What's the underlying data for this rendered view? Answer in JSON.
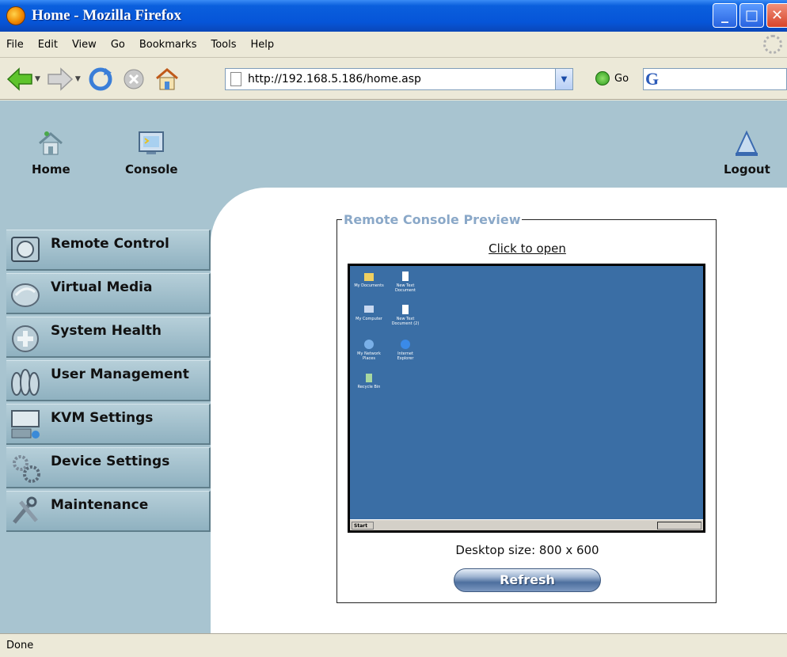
{
  "window": {
    "title": "Home - Mozilla Firefox"
  },
  "menu": [
    "File",
    "Edit",
    "View",
    "Go",
    "Bookmarks",
    "Tools",
    "Help"
  ],
  "toolbar": {
    "url": "http://192.168.5.186/home.asp",
    "go_label": "Go"
  },
  "topnav": {
    "home": "Home",
    "console": "Console",
    "logout": "Logout"
  },
  "sidebar": {
    "items": [
      {
        "label": "Remote Control",
        "icon": "monitor-icon"
      },
      {
        "label": "Virtual Media",
        "icon": "disc-icon"
      },
      {
        "label": "System Health",
        "icon": "health-icon"
      },
      {
        "label": "User Management",
        "icon": "users-icon"
      },
      {
        "label": "KVM Settings",
        "icon": "kvm-icon"
      },
      {
        "label": "Device Settings",
        "icon": "gears-icon"
      },
      {
        "label": "Maintenance",
        "icon": "tools-icon"
      }
    ]
  },
  "preview": {
    "legend": "Remote Console Preview",
    "click_to_open": "Click to open",
    "desktop_size": "Desktop size: 800 x 600",
    "refresh_label": "Refresh"
  },
  "desktop": {
    "icons": [
      {
        "label": "My Documents"
      },
      {
        "label": "New Text Document"
      },
      {
        "label": "My Computer"
      },
      {
        "label": "New Text Document (2)"
      },
      {
        "label": "My Network Places"
      },
      {
        "label": "Internet Explorer"
      },
      {
        "label": "Recycle Bin"
      }
    ],
    "start_label": "Start"
  },
  "status": {
    "text": "Done"
  },
  "colors": {
    "accent": "#0a5fdd",
    "page_bg": "#a8c4d0",
    "desktop_bg": "#3a6ea5",
    "legend": "#8aa8c8"
  }
}
